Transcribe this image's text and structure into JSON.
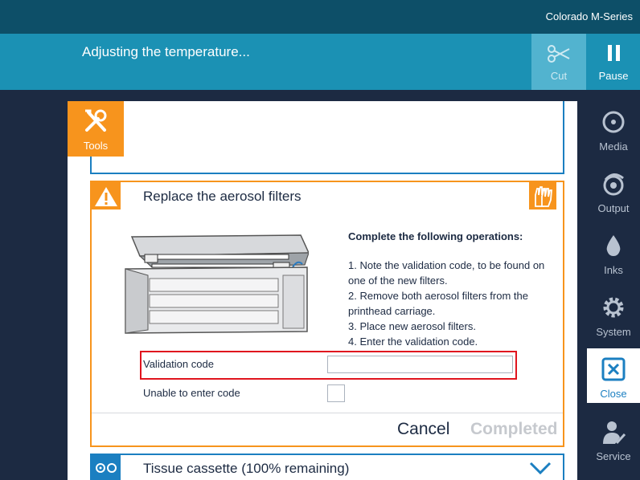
{
  "app": {
    "title": "Colorado M-Series"
  },
  "status": {
    "message": "Adjusting the temperature..."
  },
  "toolbar": {
    "cut_label": "Cut",
    "pause_label": "Pause"
  },
  "tools_tab": {
    "label": "Tools"
  },
  "sidebar": {
    "items": [
      {
        "label": "Media",
        "icon": "media-icon"
      },
      {
        "label": "Output",
        "icon": "output-icon"
      },
      {
        "label": "Inks",
        "icon": "ink-drop-icon"
      },
      {
        "label": "System",
        "icon": "gear-icon"
      },
      {
        "label": "Close",
        "icon": "close-icon",
        "active": true
      },
      {
        "label": "Service",
        "icon": "service-icon"
      }
    ]
  },
  "card": {
    "title": "Replace the aerosol filters",
    "instructions_heading": "Complete the following operations:",
    "steps": [
      "1. Note the validation code, to be found on one of the new filters.",
      "2. Remove both aerosol filters from the printhead carriage.",
      "3. Place new aerosol filters.",
      "4. Enter the validation code."
    ],
    "validation_label": "Validation code",
    "validation_value": "",
    "unable_label": "Unable to enter code",
    "unable_checked": false,
    "cancel_label": "Cancel",
    "completed_label": "Completed"
  },
  "tissue": {
    "title": "Tissue cassette (100% remaining)"
  },
  "colors": {
    "accent": "#f7941d",
    "primary": "#1b7fc1",
    "status_bar": "#1b91b4",
    "highlight": "#e0141e"
  }
}
